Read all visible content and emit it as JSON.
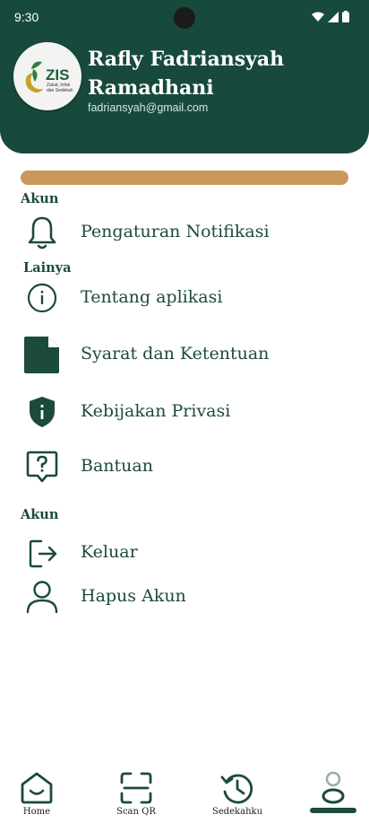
{
  "status_bar": {
    "time": "9:30"
  },
  "profile": {
    "name": "Rafly Fadriansyah Ramadhani",
    "email": "fadriansyah@gmail.com",
    "logo": {
      "title": "ZIS",
      "subtitle_line1": "Zakat, Infak",
      "subtitle_line2": "dan Sedekah"
    }
  },
  "sections": {
    "account_top": "Akun",
    "others": "Lainya",
    "account_bottom": "Akun"
  },
  "menu": {
    "notifications": "Pengaturan Notifikasi",
    "about": "Tentang aplikasi",
    "terms": "Syarat dan Ketentuan",
    "privacy": "Kebijakan Privasi",
    "help": "Bantuan",
    "logout": "Keluar",
    "delete_account": "Hapus Akun"
  },
  "nav": {
    "home": "Home",
    "scan": "Scan QR",
    "history": "Sedekahku",
    "active_tab": "profile"
  },
  "colors": {
    "primary": "#174a3c",
    "accent": "#c9985a",
    "logo_gold": "#c9a227",
    "logo_green": "#2e7d3c"
  }
}
